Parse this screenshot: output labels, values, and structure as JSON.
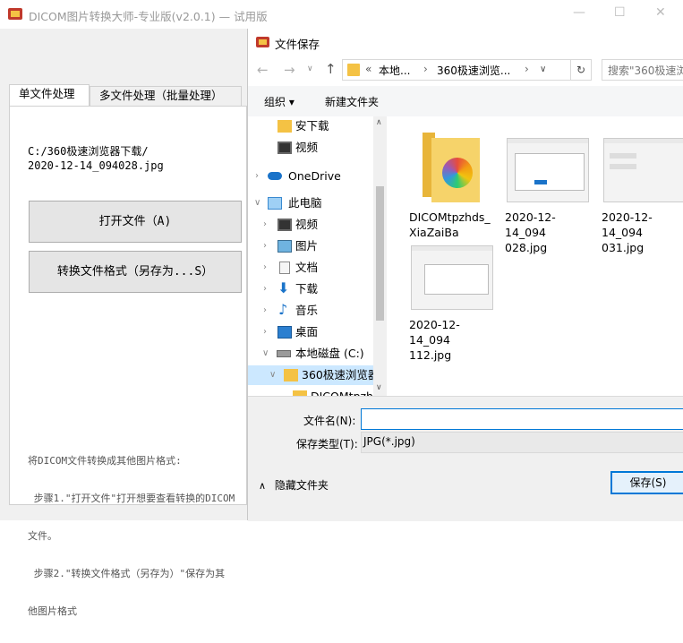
{
  "main": {
    "title": "DICOM图片转换大师-专业版(v2.0.1) — 试用版",
    "tabs": [
      "单文件处理",
      "多文件处理（批量处理）"
    ],
    "path_line1": "C:/360极速浏览器下载/",
    "path_line2": "2020-12-14_094028.jpg",
    "open_button": "打开文件（A)",
    "convert_button": "转换文件格式（另存为...S）",
    "help_lines": [
      "将DICOM文件转换成其他图片格式:",
      " 步骤1.\"打开文件\"打开想要查看转换的DICOM",
      "文件。",
      " 步骤2.\"转换文件格式（另存为）\"保存为其",
      "他图片格式"
    ]
  },
  "dialog": {
    "title": "文件保存",
    "address": {
      "prefix": "«",
      "segment1": "本地...",
      "segment2": "360极速浏览...",
      "search_placeholder": "搜索\"360极速浏"
    },
    "toolbar": {
      "organize": "组织 ▾",
      "new_folder": "新建文件夹"
    },
    "nav_items": {
      "downloads_top": "安下载",
      "videos_top": "视频",
      "onedrive": "OneDrive",
      "this_pc": "此电脑",
      "videos": "视频",
      "pictures": "图片",
      "documents": "文档",
      "downloads": "下载",
      "music": "音乐",
      "desktop": "桌面",
      "local_disk": "本地磁盘 (C:)",
      "folder_360": "360极速浏览器",
      "folder_dicom": "DICOMtpzh"
    },
    "files": [
      {
        "name_l1": "DICOMtpzhds_",
        "name_l2": "XiaZaiBa"
      },
      {
        "name_l1": "2020-12-14_094",
        "name_l2": "028.jpg"
      },
      {
        "name_l1": "2020-12-14_094",
        "name_l2": "031.jpg"
      },
      {
        "name_l1": "2020-12-14_094",
        "name_l2": "112.jpg"
      }
    ],
    "filename_label": "文件名(N):",
    "filename_value": "",
    "filetype_label": "保存类型(T):",
    "filetype_value": "JPG(*.jpg)",
    "hide_folders": "隐藏文件夹",
    "save_button": "保存(S)"
  },
  "colors": {
    "accent": "#0078d7",
    "selected_nav": "#cce8ff",
    "folder_yellow": "#f4c244"
  }
}
